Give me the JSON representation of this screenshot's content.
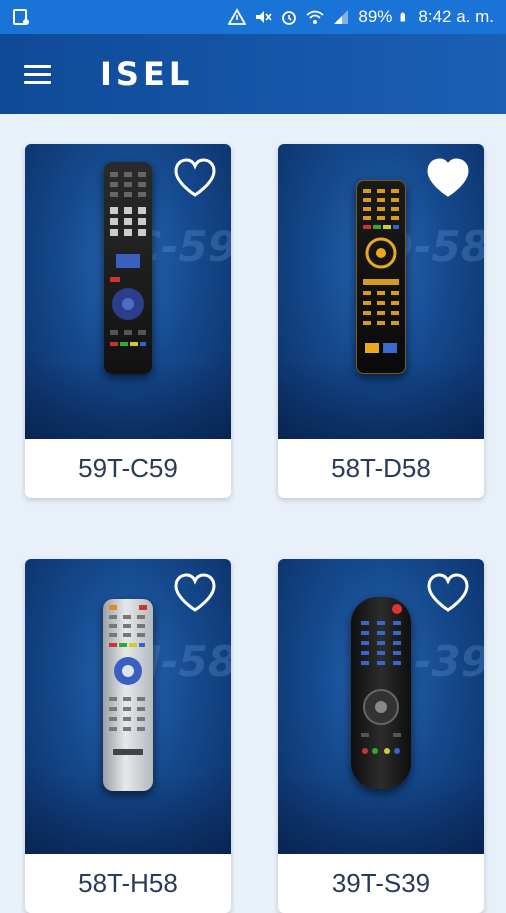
{
  "status_bar": {
    "battery": "89%",
    "time": "8:42 a. m.",
    "icons": [
      "storage-icon",
      "alert-icon",
      "mute-icon",
      "alarm-icon",
      "wifi-icon",
      "signal-icon",
      "battery-icon"
    ]
  },
  "app_bar": {
    "menu_icon": "hamburger-menu-icon",
    "logo": "ISEL"
  },
  "cards": [
    {
      "label": "59T-C59",
      "ghost": "C-59",
      "favorite": false
    },
    {
      "label": "58T-D58",
      "ghost": "D-58",
      "favorite": true
    },
    {
      "label": "58T-H58",
      "ghost": "H-58",
      "favorite": false
    },
    {
      "label": "39T-S39",
      "ghost": "S-39",
      "favorite": false
    }
  ],
  "colors": {
    "status_bar": "#1a73d6",
    "app_bar": "#0f4a97",
    "background": "#e8f0fa",
    "label_text": "#2a3a5a"
  }
}
